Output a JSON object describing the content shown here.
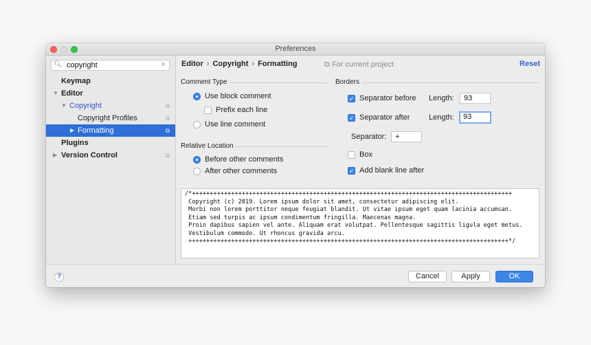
{
  "window": {
    "title": "Preferences"
  },
  "search": {
    "value": "copyright",
    "icon": "search-icon",
    "clear_icon": "clear-icon"
  },
  "sidebar": {
    "items": [
      {
        "label": "Keymap"
      },
      {
        "label": "Editor"
      },
      {
        "label": "Copyright"
      },
      {
        "label": "Copyright Profiles"
      },
      {
        "label": "Formatting"
      },
      {
        "label": "Plugins"
      },
      {
        "label": "Version Control"
      }
    ]
  },
  "breadcrumb": {
    "items": [
      "Editor",
      "Copyright",
      "Formatting"
    ],
    "separator": "›"
  },
  "scope_label": "For current project",
  "reset_label": "Reset",
  "comment_type": {
    "title": "Comment Type",
    "block": "Use block comment",
    "prefix": "Prefix each line",
    "line": "Use line comment"
  },
  "relative_location": {
    "title": "Relative Location",
    "before": "Before other comments",
    "after": "After other comments"
  },
  "borders": {
    "title": "Borders",
    "separator_before": "Separator before",
    "separator_after": "Separator after",
    "length_label": "Length:",
    "length_before": "93",
    "length_after": "93",
    "separator_label": "Separator:",
    "separator_value": "+",
    "box": "Box",
    "blank_line": "Add blank line after"
  },
  "preview": {
    "text": "/*++++++++++++++++++++++++++++++++++++++++++++++++++++++++++++++++++++++++++++++++++++++++++\n Copyright (c) 2019. Lorem ipsum dolor sit amet, consectetur adipiscing elit.\n Morbi non lorem porttitor neque feugiat blandit. Ut vitae ipsum eget quam lacinia accumsan.\n Etiam sed turpis ac ipsum condimentum fringilla. Maecenas magna.\n Proin dapibus sapien vel ante. Aliquam erat volutpat. Pellentesque sagittis ligula eget metus.\n Vestibulum commodo. Ut rhoncus gravida arcu.\n ++++++++++++++++++++++++++++++++++++++++++++++++++++++++++++++++++++++++++++++++++++++++++*/"
  },
  "footer": {
    "help": "?",
    "cancel": "Cancel",
    "apply": "Apply",
    "ok": "OK"
  },
  "colors": {
    "accent": "#3c86e6",
    "selection": "#2e6fd8",
    "link": "#2f64c8"
  }
}
